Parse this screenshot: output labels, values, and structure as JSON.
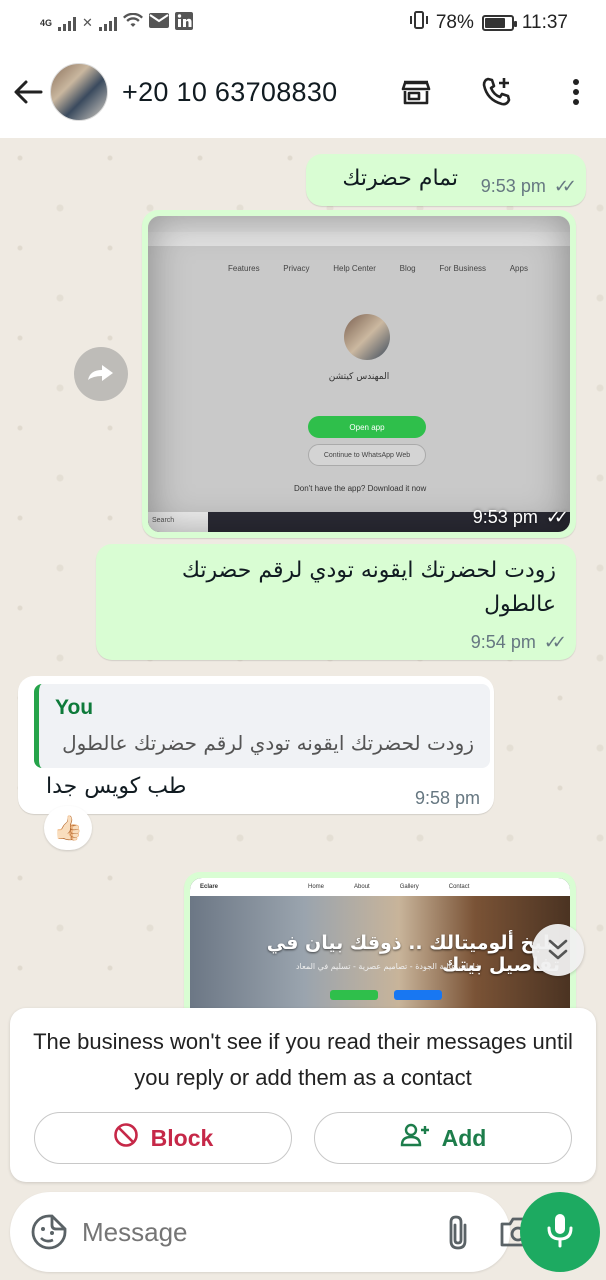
{
  "status_bar": {
    "network": "4G",
    "battery_percent": "78%",
    "battery_level": 0.78,
    "time": "11:37"
  },
  "header": {
    "contact": "+20 10 63708830",
    "icons": [
      "back-arrow-icon",
      "store-icon",
      "add-call-icon",
      "more-vert-icon"
    ]
  },
  "messages": [
    {
      "direction": "out",
      "text": "تمام حضرتك",
      "time": "9:53 pm",
      "status": "read"
    },
    {
      "direction": "out",
      "type": "image",
      "time": "9:53 pm",
      "status": "read",
      "image": {
        "nav_items": [
          "Features",
          "Privacy",
          "Help Center",
          "Blog",
          "For Business",
          "Apps"
        ],
        "profile_name": "المهندس كيتشن",
        "open_app": "Open app",
        "continue_web": "Continue to WhatsApp Web",
        "download_line": "Don't have the app? Download it now",
        "taskbar_search": "Search"
      }
    },
    {
      "direction": "out",
      "text": "زودت لحضرتك ايقونه تودي لرقم حضرتك عالطول",
      "time": "9:54 pm",
      "status": "read"
    },
    {
      "direction": "in",
      "quote": {
        "author": "You",
        "text": "زودت لحضرتك ايقونه تودي لرقم حضرتك عالطول"
      },
      "text": "طب كويس جدا",
      "time": "9:58 pm",
      "reaction": "👍🏻"
    },
    {
      "direction": "out",
      "type": "image",
      "image": {
        "brand": "Eclare",
        "nav_items": [
          "Home",
          "About",
          "Gallery",
          "Contact"
        ],
        "headline": "طبخ ألوميتالك .. ذوقك بيان في تفاصيل بيتك",
        "subline": "خامات عالية الجودة - تصاميم عصرية - تسليم في المعاد"
      }
    }
  ],
  "business_notice": {
    "text": "The business won't see if you read their messages until you reply or add them as a contact",
    "block_label": "Block",
    "add_label": "Add"
  },
  "composer": {
    "placeholder": "Message"
  },
  "colors": {
    "outgoing_bubble": "#d9fdd3",
    "incoming_bubble": "#ffffff",
    "chat_background": "#efeae2",
    "block_red": "#c62848",
    "add_green": "#1d7d4b",
    "mic_green": "#1daa61"
  }
}
